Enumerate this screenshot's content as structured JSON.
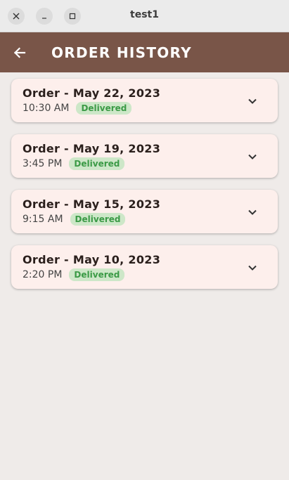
{
  "window": {
    "title": "test1"
  },
  "appbar": {
    "title": "ORDER HISTORY"
  },
  "orders": [
    {
      "title": "Order - May 22, 2023",
      "time": "10:30 AM",
      "status": "Delivered"
    },
    {
      "title": "Order - May 19, 2023",
      "time": "3:45 PM",
      "status": "Delivered"
    },
    {
      "title": "Order - May 15, 2023",
      "time": "9:15 AM",
      "status": "Delivered"
    },
    {
      "title": "Order - May 10, 2023",
      "time": "2:20 PM",
      "status": "Delivered"
    }
  ],
  "colors": {
    "appbar": "#795548",
    "card": "#fdefec",
    "badge_bg": "#cde7c8",
    "badge_text": "#3b9a46"
  },
  "icons": {
    "back": "arrow-left-icon",
    "expand": "chevron-down-icon"
  }
}
